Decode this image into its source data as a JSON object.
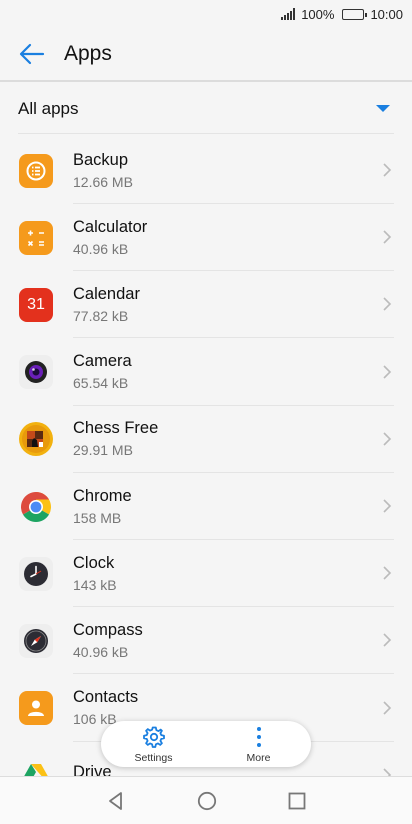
{
  "status_bar": {
    "signal_pct": "100%",
    "time": "10:00"
  },
  "header": {
    "title": "Apps"
  },
  "filter": {
    "label": "All apps"
  },
  "apps": [
    {
      "name": "Backup",
      "size": "12.66 MB",
      "icon": "backup-icon"
    },
    {
      "name": "Calculator",
      "size": "40.96 kB",
      "icon": "calculator-icon"
    },
    {
      "name": "Calendar",
      "size": "77.82 kB",
      "icon": "calendar-icon",
      "icon_text": "31"
    },
    {
      "name": "Camera",
      "size": "65.54 kB",
      "icon": "camera-icon"
    },
    {
      "name": "Chess Free",
      "size": "29.91 MB",
      "icon": "chess-icon"
    },
    {
      "name": "Chrome",
      "size": "158 MB",
      "icon": "chrome-icon"
    },
    {
      "name": "Clock",
      "size": "143 kB",
      "icon": "clock-icon"
    },
    {
      "name": "Compass",
      "size": "40.96 kB",
      "icon": "compass-icon"
    },
    {
      "name": "Contacts",
      "size": "106 kB",
      "icon": "contacts-icon"
    },
    {
      "name": "Drive",
      "size": "",
      "icon": "drive-icon"
    }
  ],
  "floating_bar": {
    "settings_label": "Settings",
    "more_label": "More"
  },
  "colors": {
    "accent": "#1a7fe0",
    "orange": "#f59a1c",
    "red": "#e3311d"
  }
}
